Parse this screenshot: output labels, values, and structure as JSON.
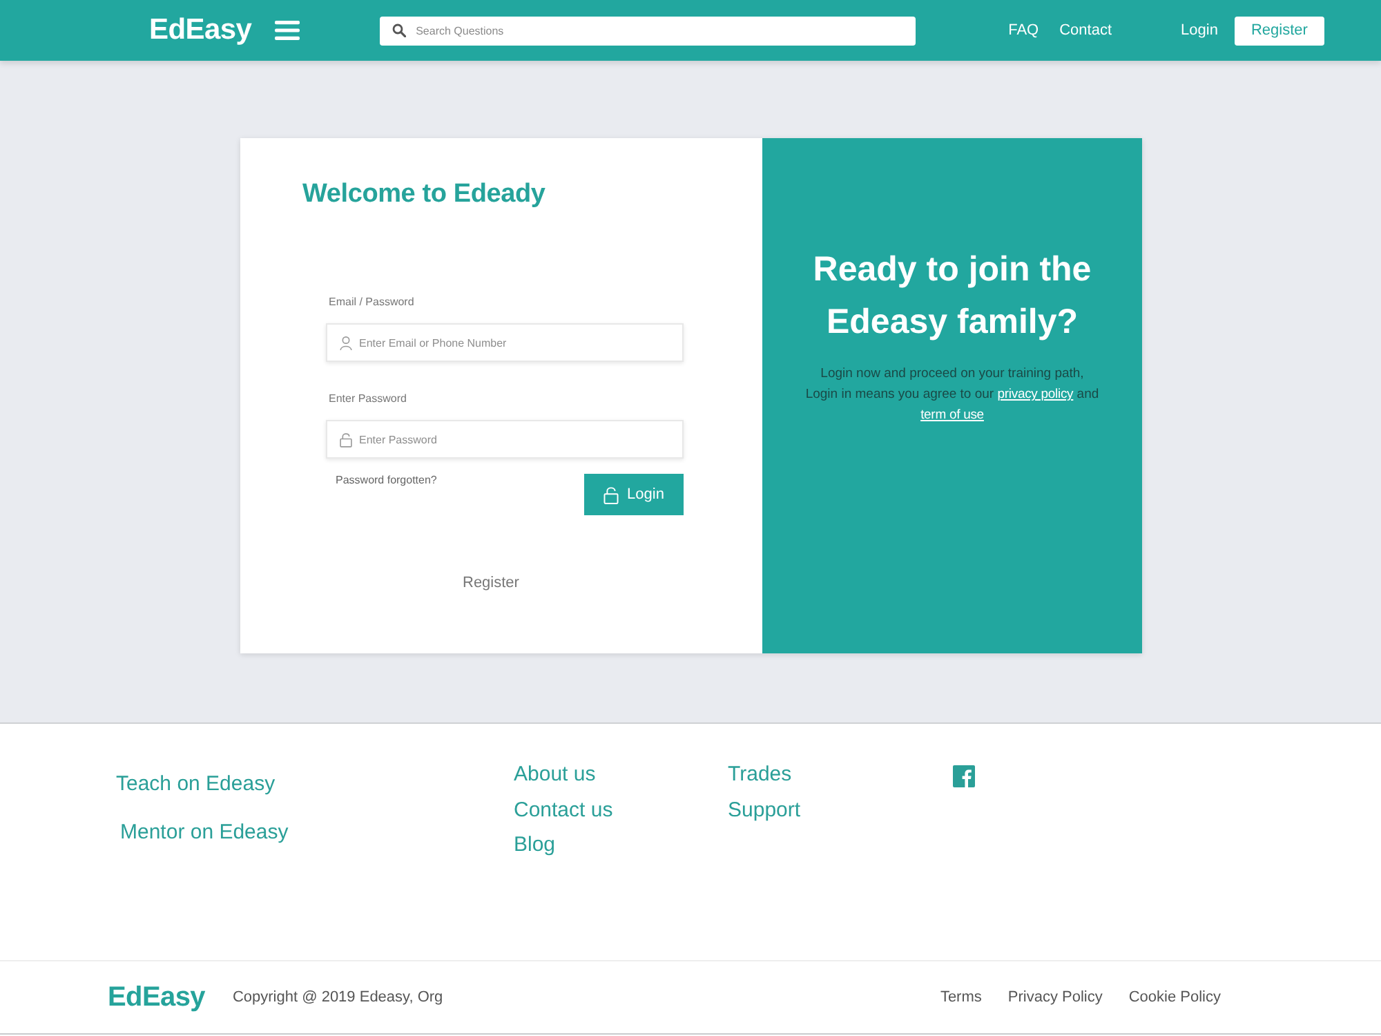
{
  "header": {
    "logo": "EdEasy",
    "search": {
      "placeholder": "Search Questions"
    },
    "nav": [
      "FAQ",
      "Contact"
    ],
    "login": "Login",
    "register": "Register"
  },
  "login_card": {
    "title": "Welcome to Edeady",
    "fields": [
      {
        "kind": "user",
        "label": "Email / Password",
        "placeholder": "Enter Email or Phone Number"
      },
      {
        "kind": "lock",
        "label": "Enter Password",
        "placeholder": "Enter Password"
      }
    ],
    "forgot": "Password forgotten?",
    "login_button": "Login",
    "register_link": "Register"
  },
  "promo": {
    "heading": "Ready to join the Edeasy family?",
    "text": [
      {
        "kind": "text",
        "text": "Login now and proceed on your training path, Login in means you agree to our"
      },
      {
        "kind": "link",
        "text": "privacy policy"
      },
      {
        "kind": "text",
        "text": "and"
      },
      {
        "kind": "link",
        "text": "term of use"
      }
    ]
  },
  "footer": {
    "side_links": [
      "Teach on Edeasy",
      "Mentor on Edeasy"
    ],
    "columns": [
      [
        "About us",
        "Contact us",
        "Blog"
      ],
      [
        "Trades",
        "Support"
      ]
    ]
  },
  "bottom_bar": {
    "logo": "EdEasy",
    "copyright": "Copyright @ 2019 Edeasy, Org",
    "links": [
      "Terms",
      "Privacy Policy",
      "Cookie Policy"
    ]
  }
}
